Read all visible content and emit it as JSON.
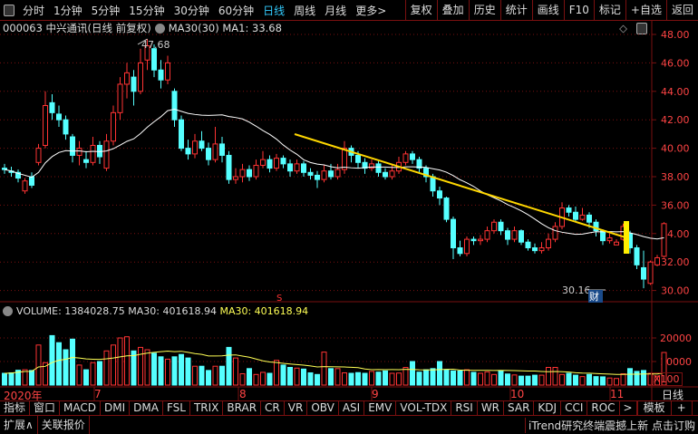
{
  "toolbar": {
    "periods": [
      "分时",
      "1分钟",
      "5分钟",
      "15分钟",
      "30分钟",
      "60分钟",
      "日线",
      "周线",
      "月线",
      "更多>"
    ],
    "active": "日线",
    "right": [
      "复权",
      "叠加",
      "历史",
      "统计",
      "画线",
      "F10",
      "标记",
      "+自选",
      "返回"
    ]
  },
  "info": {
    "title": "000063 中兴通讯(日线 前复权)",
    "ma_label": "MA30(30)",
    "ma_value": "MA1: 33.68"
  },
  "volume_header": {
    "volume": "VOLUME: 1384028.75",
    "ma30": "MA30: 401618.94",
    "ma30_yellow": "MA30: 401618.94"
  },
  "annotations": {
    "high": "47.68",
    "low": "30.16",
    "cai": "财",
    "s": "S"
  },
  "volume_unit": "X100",
  "date_axis": {
    "labels": [
      "2020年",
      "7",
      "8",
      "9",
      "10",
      "11"
    ],
    "period": "日线"
  },
  "tabs": [
    "指标",
    "窗口",
    "MACD",
    "DMI",
    "DMA",
    "FSL",
    "TRIX",
    "BRAR",
    "CR",
    "VR",
    "OBV",
    "ASI",
    "EMV",
    "VOL-TDX",
    "RSI",
    "WR",
    "SAR",
    "KDJ",
    "CCI",
    "ROC",
    ">"
  ],
  "tabs_right": [
    "模板",
    "+",
    "-"
  ],
  "bottom": {
    "left": [
      "扩展∧",
      "关联报价"
    ],
    "right": "iTrend研究终端震撼上新 点击订购"
  },
  "colors": {
    "up": "#ff3333",
    "down": "#55ffff",
    "ma": "#ffffff",
    "vol_ma": "#ffff55",
    "trend": "#ffd700",
    "grid": "#7a1010",
    "axis_text": "#ff4444"
  },
  "chart_data": {
    "type": "candlestick",
    "price_axis": {
      "ticks": [
        "48.00",
        "46.00",
        "44.00",
        "42.00",
        "40.00",
        "38.00",
        "36.00",
        "34.00",
        "32.00",
        "30.00"
      ],
      "range": [
        30,
        48
      ]
    },
    "volume_axis": {
      "ticks": [
        "20000",
        "10000"
      ],
      "range": [
        0,
        25000
      ]
    },
    "candles_ohlcv": [
      [
        38.6,
        38.5,
        38.9,
        38.2,
        5000
      ],
      [
        38.4,
        38.3,
        38.7,
        38.0,
        5200
      ],
      [
        38.3,
        37.9,
        38.5,
        37.6,
        6300
      ],
      [
        37.0,
        37.7,
        37.9,
        36.8,
        6500
      ],
      [
        38.0,
        37.4,
        38.3,
        37.2,
        6200
      ],
      [
        39.0,
        40.0,
        40.3,
        38.8,
        17000
      ],
      [
        40.2,
        43.0,
        44.0,
        40.0,
        9500
      ],
      [
        43.2,
        42.5,
        43.8,
        42.0,
        21000
      ],
      [
        42.4,
        42.0,
        43.0,
        41.5,
        18000
      ],
      [
        42.0,
        41.0,
        42.3,
        40.6,
        15000
      ],
      [
        40.8,
        39.5,
        41.0,
        39.0,
        19500
      ],
      [
        39.5,
        40.0,
        40.5,
        38.8,
        8500
      ],
      [
        39.2,
        39.0,
        39.8,
        38.6,
        6500
      ],
      [
        39.0,
        40.2,
        40.8,
        38.8,
        9500
      ],
      [
        40.2,
        39.4,
        40.5,
        38.9,
        10000
      ],
      [
        38.6,
        40.5,
        41.0,
        38.4,
        14500
      ],
      [
        40.5,
        42.5,
        43.0,
        40.2,
        17000
      ],
      [
        42.5,
        44.5,
        45.0,
        42.0,
        20000
      ],
      [
        44.5,
        45.3,
        46.0,
        43.5,
        20500
      ],
      [
        45.0,
        44.0,
        45.5,
        43.0,
        14500
      ],
      [
        44.0,
        46.0,
        47.0,
        43.8,
        16000
      ],
      [
        46.2,
        47.2,
        47.68,
        45.5,
        15000
      ],
      [
        47.0,
        45.5,
        47.3,
        45.0,
        13500
      ],
      [
        45.5,
        44.8,
        46.2,
        44.2,
        12000
      ],
      [
        44.8,
        46.0,
        46.5,
        44.5,
        11000
      ],
      [
        44.0,
        42.0,
        44.2,
        41.5,
        12000
      ],
      [
        42.0,
        40.0,
        42.3,
        39.8,
        13000
      ],
      [
        40.0,
        39.6,
        40.6,
        39.2,
        11500
      ],
      [
        39.6,
        40.5,
        41.0,
        39.3,
        8000
      ],
      [
        40.5,
        40.0,
        41.2,
        39.8,
        8000
      ],
      [
        40.0,
        39.2,
        40.4,
        38.8,
        6200
      ],
      [
        39.2,
        40.3,
        41.5,
        39.0,
        8000
      ],
      [
        40.3,
        39.5,
        40.8,
        39.0,
        8000
      ],
      [
        39.5,
        37.8,
        39.8,
        37.5,
        16000
      ],
      [
        37.8,
        38.0,
        38.6,
        37.5,
        11500
      ],
      [
        38.0,
        38.5,
        38.9,
        37.6,
        4800
      ],
      [
        38.5,
        38.0,
        38.8,
        37.7,
        7000
      ],
      [
        38.0,
        38.8,
        39.2,
        37.8,
        4500
      ],
      [
        38.8,
        39.2,
        39.8,
        38.6,
        5400
      ],
      [
        39.2,
        38.6,
        39.5,
        38.3,
        5000
      ],
      [
        38.6,
        39.3,
        39.6,
        38.4,
        10500
      ],
      [
        39.3,
        38.9,
        39.5,
        38.6,
        8500
      ],
      [
        38.9,
        38.4,
        39.2,
        38.0,
        7500
      ],
      [
        38.4,
        38.9,
        39.2,
        38.2,
        7200
      ],
      [
        38.9,
        38.3,
        39.1,
        38.0,
        6800
      ],
      [
        38.3,
        38.1,
        38.6,
        37.8,
        5200
      ],
      [
        38.1,
        37.8,
        38.4,
        37.2,
        4500
      ],
      [
        37.8,
        38.4,
        38.8,
        37.6,
        14000
      ],
      [
        38.4,
        38.0,
        38.9,
        37.8,
        7000
      ],
      [
        38.0,
        38.5,
        38.9,
        37.8,
        7000
      ],
      [
        38.5,
        40.0,
        40.5,
        38.2,
        5200
      ],
      [
        40.0,
        39.5,
        40.2,
        39.0,
        5000
      ],
      [
        39.5,
        39.0,
        39.8,
        38.6,
        5300
      ],
      [
        39.0,
        38.6,
        39.3,
        38.2,
        5000
      ],
      [
        38.6,
        38.9,
        39.2,
        38.4,
        5800
      ],
      [
        38.9,
        38.3,
        39.1,
        38.0,
        5500
      ],
      [
        38.3,
        38.0,
        38.6,
        37.8,
        6000
      ],
      [
        38.0,
        38.4,
        38.8,
        37.8,
        5000
      ],
      [
        38.4,
        39.0,
        39.4,
        38.2,
        5100
      ],
      [
        39.0,
        39.6,
        39.8,
        38.8,
        7500
      ],
      [
        39.6,
        39.2,
        39.8,
        38.9,
        10000
      ],
      [
        39.2,
        38.6,
        39.4,
        38.3,
        5500
      ],
      [
        38.6,
        38.0,
        38.8,
        37.6,
        6500
      ],
      [
        38.0,
        37.0,
        38.2,
        36.6,
        7000
      ],
      [
        37.0,
        36.5,
        37.3,
        36.0,
        10000
      ],
      [
        36.5,
        35.0,
        36.6,
        34.8,
        6500
      ],
      [
        35.0,
        33.0,
        35.2,
        32.2,
        6000
      ],
      [
        33.0,
        32.6,
        33.5,
        32.4,
        6000
      ],
      [
        32.6,
        33.6,
        33.8,
        32.4,
        6500
      ],
      [
        33.6,
        33.5,
        33.8,
        33.2,
        5400
      ],
      [
        33.5,
        33.6,
        33.9,
        33.2,
        5000
      ],
      [
        33.6,
        34.2,
        34.5,
        33.4,
        5600
      ],
      [
        34.2,
        34.8,
        35.0,
        34.0,
        4500
      ],
      [
        34.8,
        34.2,
        35.0,
        33.9,
        6000
      ],
      [
        34.2,
        33.6,
        34.4,
        33.2,
        4700
      ],
      [
        33.6,
        34.2,
        34.5,
        33.4,
        4300
      ],
      [
        34.2,
        33.4,
        34.3,
        33.2,
        3800
      ],
      [
        33.4,
        33.0,
        33.6,
        32.8,
        3800
      ],
      [
        33.0,
        32.8,
        33.3,
        32.6,
        4200
      ],
      [
        32.8,
        33.0,
        33.4,
        32.6,
        4200
      ],
      [
        33.0,
        33.6,
        34.0,
        32.8,
        7500
      ],
      [
        33.6,
        34.5,
        34.8,
        33.4,
        7500
      ],
      [
        34.5,
        35.8,
        36.2,
        34.3,
        4500
      ],
      [
        35.8,
        35.5,
        36.0,
        35.2,
        5000
      ],
      [
        35.5,
        35.0,
        35.9,
        34.8,
        4200
      ],
      [
        35.0,
        35.3,
        35.8,
        34.9,
        3600
      ],
      [
        35.3,
        34.8,
        35.5,
        34.4,
        4500
      ],
      [
        34.8,
        34.2,
        35.0,
        33.8,
        3600
      ],
      [
        34.2,
        33.5,
        34.3,
        33.2,
        3500
      ],
      [
        33.5,
        33.7,
        34.0,
        33.3,
        3000
      ],
      [
        33.2,
        33.4,
        33.6,
        33.2,
        2800
      ],
      [
        33.6,
        34.5,
        34.7,
        33.5,
        4800
      ],
      [
        34.0,
        33.0,
        34.2,
        32.6,
        7000
      ],
      [
        33.0,
        31.8,
        33.2,
        31.5,
        5800
      ],
      [
        31.6,
        30.8,
        32.8,
        30.16,
        6200
      ],
      [
        30.5,
        32.0,
        32.1,
        30.4,
        5000
      ],
      [
        31.8,
        32.3,
        32.5,
        31.7,
        3800
      ],
      [
        32.4,
        34.7,
        34.8,
        32.3,
        13840
      ]
    ]
  }
}
